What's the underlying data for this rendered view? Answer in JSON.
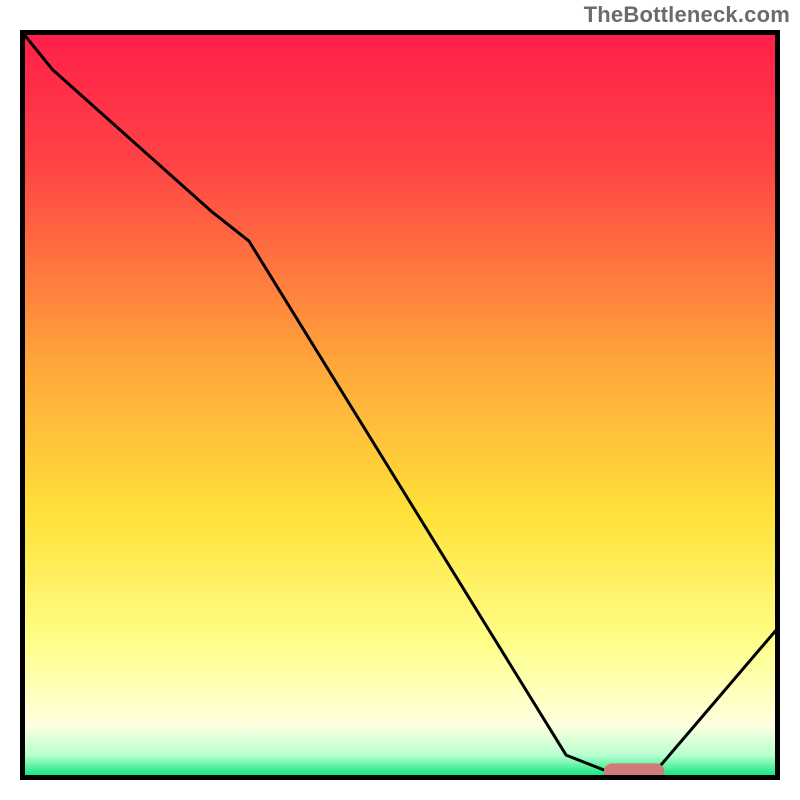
{
  "watermark": "TheBottleneck.com",
  "chart_data": {
    "type": "line",
    "title": "",
    "xlabel": "",
    "ylabel": "",
    "xlim": [
      0,
      100
    ],
    "ylim": [
      0,
      100
    ],
    "grid": false,
    "gradient_stops": [
      {
        "offset": 0.0,
        "color": "#ff1f4b"
      },
      {
        "offset": 0.18,
        "color": "#ff4444"
      },
      {
        "offset": 0.45,
        "color": "#ffa83a"
      },
      {
        "offset": 0.65,
        "color": "#ffe23a"
      },
      {
        "offset": 0.82,
        "color": "#ffff8a"
      },
      {
        "offset": 0.93,
        "color": "#ffffe0"
      },
      {
        "offset": 0.97,
        "color": "#b8ffd0"
      },
      {
        "offset": 1.0,
        "color": "#00e676"
      }
    ],
    "series": [
      {
        "name": "bottleneck-curve",
        "x": [
          0,
          4,
          25,
          30,
          72,
          77,
          84,
          100
        ],
        "y": [
          100,
          95,
          76,
          72,
          3,
          1,
          1,
          20
        ]
      }
    ],
    "marker": {
      "name": "optimal-range",
      "shape": "capsule",
      "color": "#d17a7a",
      "x_range": [
        77,
        85
      ],
      "y": 0.8,
      "thickness": 2.2
    },
    "frame_color": "#000000",
    "frame_width": 5
  }
}
